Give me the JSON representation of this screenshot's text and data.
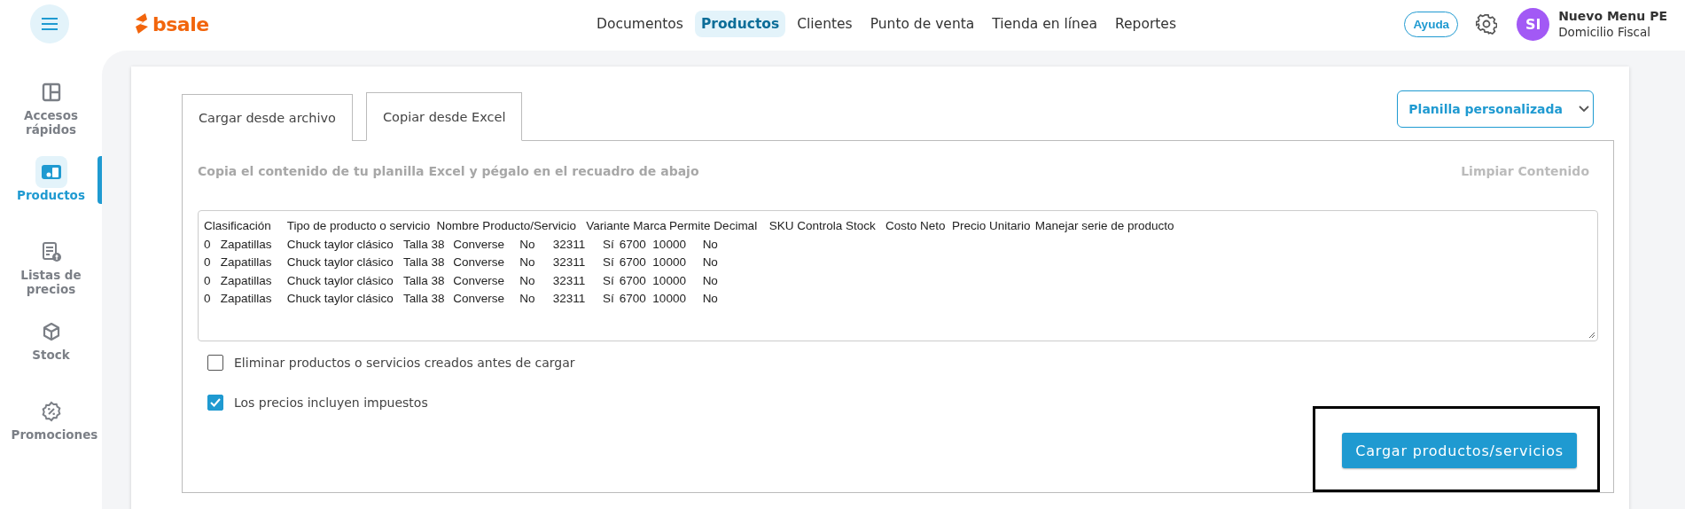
{
  "topbar": {
    "logo": "bsale",
    "nav": [
      {
        "label": "Documentos",
        "selected": false
      },
      {
        "label": "Productos",
        "selected": true
      },
      {
        "label": "Clientes",
        "selected": false
      },
      {
        "label": "Punto de venta",
        "selected": false
      },
      {
        "label": "Tienda en línea",
        "selected": false
      },
      {
        "label": "Reportes",
        "selected": false
      }
    ],
    "help": "Ayuda",
    "user": {
      "initials": "SI",
      "name": "Nuevo Menu PE",
      "branch": "Domicilio Fiscal"
    }
  },
  "sidebar": {
    "items": [
      {
        "kind": "quick",
        "label": "Accesos rápidos",
        "selected": false
      },
      {
        "kind": "products",
        "label": "Productos",
        "selected": true
      },
      {
        "kind": "prices",
        "label": "Listas de precios",
        "selected": false
      },
      {
        "kind": "stock",
        "label": "Stock",
        "selected": false
      },
      {
        "kind": "promos",
        "label": "Promociones",
        "selected": false
      }
    ]
  },
  "tabs": [
    {
      "label": "Cargar desde archivo",
      "selected": false
    },
    {
      "label": "Copiar desde Excel",
      "selected": true
    }
  ],
  "template_select": {
    "value": "Planilla personalizada"
  },
  "instructions": "Copia el contenido de tu planilla Excel y pégalo en el recuadro de abajo",
  "clear": "Limpiar Contenido",
  "paste_area": {
    "lines": [
      "Clasificación\tTipo de producto o servicio\tNombre Producto/Servicio\tVariante Marca\tPermite Decimal\tSKU Controla Stock\tCosto Neto\tPrecio Unitario\tManejar serie de producto",
      "0\tZapatillas\tChuck taylor clásico\tTalla 38\tConverse\tNo\t32311\tSí\t6700\t10000\tNo",
      "0\tZapatillas\tChuck taylor clásico\tTalla 38\tConverse\tNo\t32311\tSí\t6700\t10000\tNo",
      "0\tZapatillas\tChuck taylor clásico\tTalla 38\tConverse\tNo\t32311\tSí\t6700\t10000\tNo",
      "0\tZapatillas\tChuck taylor clásico\tTalla 38\tConverse\tNo\t32311\tSí\t6700\t10000\tNo"
    ]
  },
  "options": [
    {
      "label": "Eliminar productos o servicios creados antes de cargar",
      "checked": false
    },
    {
      "label": "Los precios incluyen impuestos",
      "checked": true
    }
  ],
  "submit": {
    "label": "Cargar productos/servicios",
    "highlighted": true
  }
}
